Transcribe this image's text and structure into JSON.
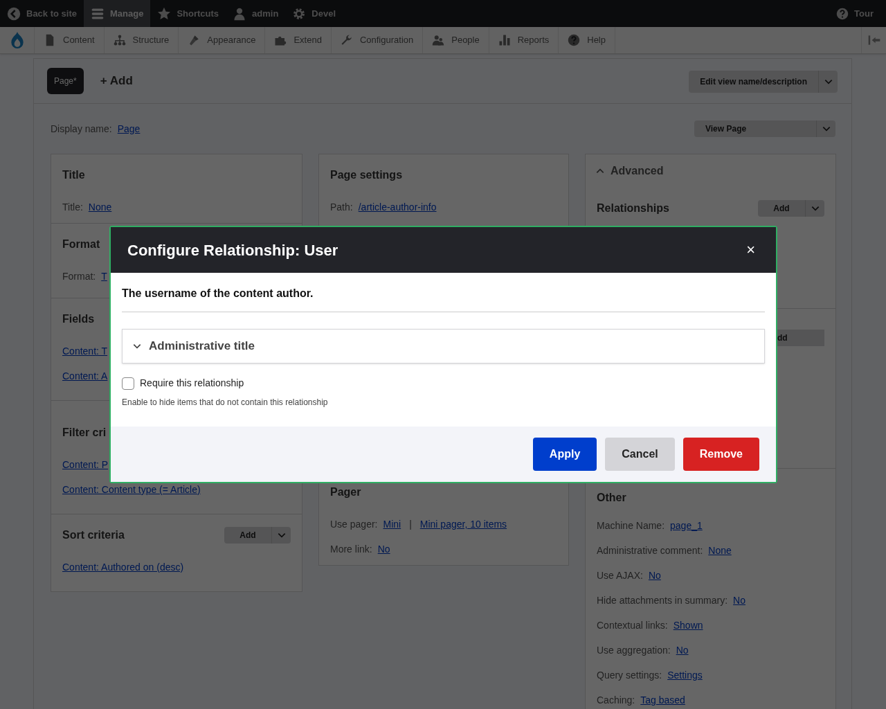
{
  "toolbar": {
    "items": [
      {
        "label": "Back to site",
        "selected": false
      },
      {
        "label": "Manage",
        "selected": true
      },
      {
        "label": "Shortcuts",
        "selected": false
      },
      {
        "label": "admin",
        "selected": false
      },
      {
        "label": "Devel",
        "selected": false
      }
    ],
    "tour": "Tour"
  },
  "admin_menu": [
    "Content",
    "Structure",
    "Appearance",
    "Extend",
    "Configuration",
    "People",
    "Reports",
    "Help"
  ],
  "display_tabs": [
    {
      "label": "Page*",
      "selected": true
    }
  ],
  "add_display": "+ Add",
  "edit_view_button": "Edit view name/description",
  "display_name": {
    "label": "Display name:",
    "value": "Page"
  },
  "view_button": "View Page",
  "columns": [
    {
      "sections": [
        {
          "title": "Title",
          "rows": [
            {
              "label": "Title:",
              "links": [
                "None"
              ]
            }
          ]
        },
        {
          "title": "Format",
          "rows": [
            {
              "label": "Format:",
              "links": [
                "T"
              ]
            }
          ]
        },
        {
          "title": "Fields",
          "links": [
            "Content: T",
            "Content: A"
          ]
        },
        {
          "title": "Filter cri",
          "links": [
            "Content: P",
            "Content: Content type (= Article)"
          ]
        },
        {
          "title": "Sort criteria",
          "add_button": "Add",
          "links": [
            "Content: Authored on (desc)"
          ]
        }
      ]
    },
    {
      "sections": [
        {
          "title": "Page settings",
          "rows": [
            {
              "label": "Path:",
              "links": [
                "/article-author-info"
              ]
            }
          ]
        },
        {
          "title": "Pager",
          "rows": [
            {
              "label": "Use pager:",
              "links": [
                "Mini",
                "Mini pager, 10 items"
              ],
              "separator": "|"
            },
            {
              "label": "More link:",
              "links": [
                "No"
              ]
            }
          ]
        }
      ]
    },
    {
      "advanced": {
        "title": "Advanced",
        "expanded": true
      },
      "sections": [
        {
          "title": "Relationships",
          "add_button": "Add"
        },
        {
          "add_button": "dd",
          "button_cut": true
        },
        {
          "title": "Other",
          "rows": [
            {
              "label": "Machine Name:",
              "links": [
                "page_1"
              ]
            },
            {
              "label": "Administrative comment:",
              "links": [
                "None"
              ]
            },
            {
              "label": "Use AJAX:",
              "links": [
                "No"
              ]
            },
            {
              "label": "Hide attachments in summary:",
              "links": [
                "No"
              ]
            },
            {
              "label": "Contextual links:",
              "links": [
                "Shown"
              ]
            },
            {
              "label": "Use aggregation:",
              "links": [
                "No"
              ]
            },
            {
              "label": "Query settings:",
              "links": [
                "Settings"
              ]
            },
            {
              "label": "Caching:",
              "links": [
                "Tag based"
              ]
            }
          ]
        }
      ]
    }
  ],
  "modal": {
    "title": "Configure Relationship: User",
    "close": "×",
    "description": "The username of the content author.",
    "details": {
      "label": "Administrative title",
      "expanded": false
    },
    "checkbox": {
      "label": "Require this relationship",
      "checked": false
    },
    "help": "Enable to hide items that do not contain this relationship",
    "buttons": [
      {
        "label": "Apply",
        "kind": "primary"
      },
      {
        "label": "Cancel",
        "kind": "secondary"
      },
      {
        "label": "Remove",
        "kind": "danger"
      }
    ]
  }
}
